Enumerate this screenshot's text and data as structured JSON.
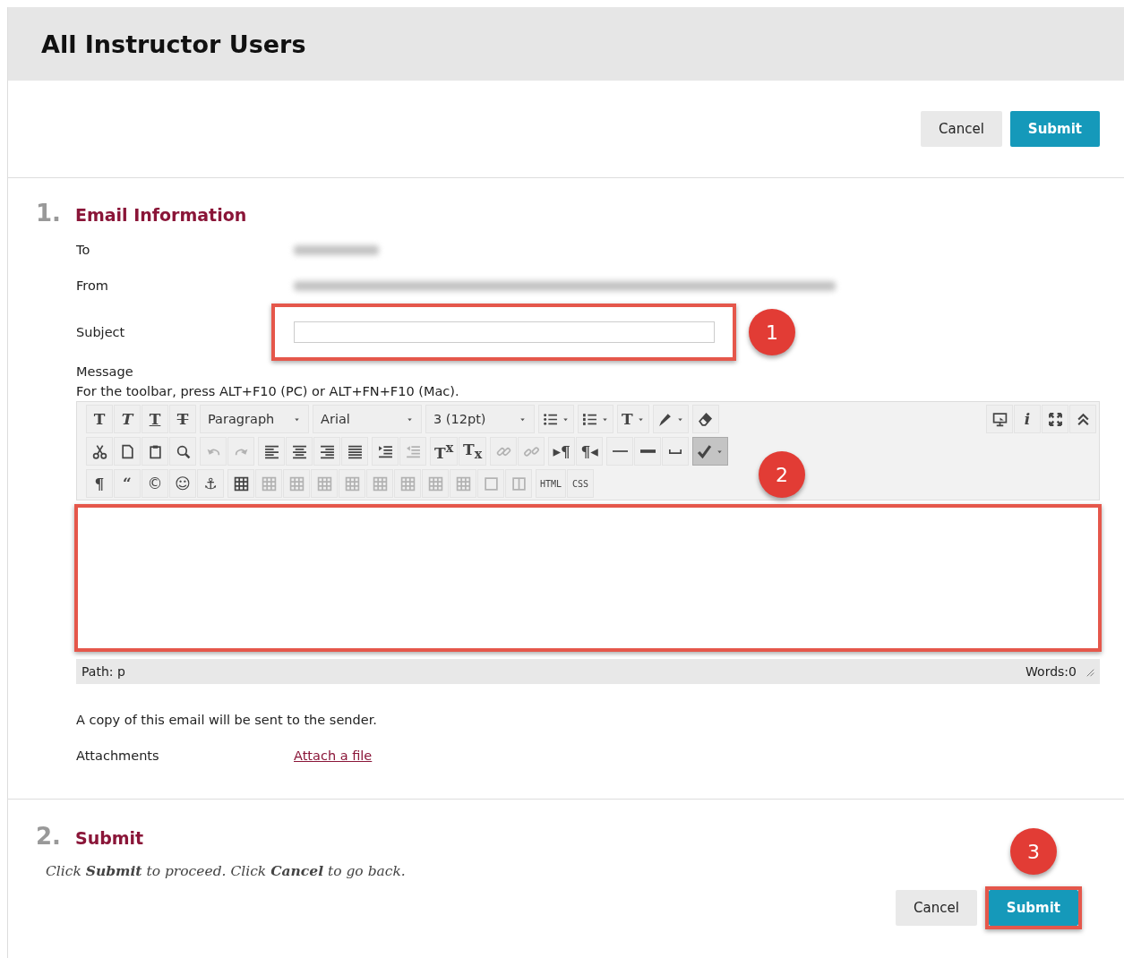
{
  "page": {
    "title": "All Instructor Users"
  },
  "top_buttons": [
    {
      "label": "Cancel",
      "kind": "secondary",
      "highlighted": false
    },
    {
      "label": "Submit",
      "kind": "primary",
      "highlighted": false
    }
  ],
  "email_section": {
    "number": "1.",
    "title": "Email Information",
    "fields": [
      {
        "label": "To",
        "kind": "redacted"
      },
      {
        "label": "From",
        "kind": "redacted"
      },
      {
        "label": "Subject",
        "kind": "input",
        "highlighted": true,
        "callout": "1"
      }
    ],
    "message": {
      "label": "Message",
      "hint": "For the toolbar, press ALT+F10 (PC) or ALT+FN+F10 (Mac).",
      "toolbar": {
        "rows": [
          {
            "groups": [
              {
                "items": [
                  {
                    "kind": "glyph",
                    "glyph": "T",
                    "caret": false,
                    "disabled": false,
                    "pressed": false
                  },
                  {
                    "kind": "glyph",
                    "glyph": "T",
                    "caret": false,
                    "disabled": false,
                    "pressed": false
                  },
                  {
                    "kind": "glyph",
                    "glyph": "T",
                    "caret": false,
                    "disabled": false,
                    "pressed": false
                  },
                  {
                    "kind": "glyph",
                    "glyph": "T",
                    "caret": false,
                    "disabled": false,
                    "pressed": false
                  }
                ]
              },
              {
                "items": [
                  {
                    "kind": "select",
                    "label": "Paragraph",
                    "caret": true,
                    "disabled": false,
                    "pressed": false
                  }
                ]
              },
              {
                "items": [
                  {
                    "kind": "select",
                    "label": "Arial",
                    "caret": true,
                    "disabled": false,
                    "pressed": false
                  }
                ]
              },
              {
                "items": [
                  {
                    "kind": "select",
                    "label": "3 (12pt)",
                    "caret": true,
                    "disabled": false,
                    "pressed": false
                  }
                ]
              },
              {
                "items": [
                  {
                    "kind": "icon",
                    "caret": true,
                    "disabled": false,
                    "pressed": false
                  }
                ]
              },
              {
                "items": [
                  {
                    "kind": "icon",
                    "caret": true,
                    "disabled": false,
                    "pressed": false
                  }
                ]
              },
              {
                "items": [
                  {
                    "kind": "glyph",
                    "glyph": "T",
                    "caret": true,
                    "disabled": false,
                    "pressed": false
                  }
                ]
              },
              {
                "items": [
                  {
                    "kind": "icon",
                    "caret": true,
                    "disabled": false,
                    "pressed": false
                  }
                ]
              },
              {
                "items": [
                  {
                    "kind": "icon",
                    "caret": false,
                    "disabled": false,
                    "pressed": false
                  }
                ]
              }
            ],
            "end_groups": [
              {
                "items": [
                  {
                    "kind": "icon",
                    "caret": false,
                    "disabled": false,
                    "pressed": false
                  },
                  {
                    "kind": "glyph",
                    "glyph": "i",
                    "caret": false,
                    "disabled": false,
                    "pressed": false
                  },
                  {
                    "kind": "icon",
                    "caret": false,
                    "disabled": false,
                    "pressed": false
                  },
                  {
                    "kind": "icon",
                    "caret": false,
                    "disabled": false,
                    "pressed": false
                  }
                ]
              }
            ]
          },
          {
            "groups": [
              {
                "items": [
                  {
                    "kind": "icon",
                    "caret": false,
                    "disabled": false,
                    "pressed": false
                  },
                  {
                    "kind": "icon",
                    "caret": false,
                    "disabled": false,
                    "pressed": false
                  },
                  {
                    "kind": "icon",
                    "caret": false,
                    "disabled": false,
                    "pressed": false
                  },
                  {
                    "kind": "icon",
                    "caret": false,
                    "disabled": false,
                    "pressed": false
                  }
                ]
              },
              {
                "items": [
                  {
                    "kind": "icon",
                    "caret": false,
                    "disabled": true,
                    "pressed": false
                  },
                  {
                    "kind": "icon",
                    "caret": false,
                    "disabled": true,
                    "pressed": false
                  }
                ]
              },
              {
                "items": [
                  {
                    "kind": "icon",
                    "caret": false,
                    "disabled": false,
                    "pressed": false
                  },
                  {
                    "kind": "icon",
                    "caret": false,
                    "disabled": false,
                    "pressed": false
                  },
                  {
                    "kind": "icon",
                    "caret": false,
                    "disabled": false,
                    "pressed": false
                  },
                  {
                    "kind": "icon",
                    "caret": false,
                    "disabled": false,
                    "pressed": false
                  }
                ]
              },
              {
                "items": [
                  {
                    "kind": "icon",
                    "caret": false,
                    "disabled": false,
                    "pressed": false
                  },
                  {
                    "kind": "icon",
                    "caret": false,
                    "disabled": true,
                    "pressed": false
                  }
                ]
              },
              {
                "items": [
                  {
                    "kind": "glyph",
                    "glyph": "T$^{x}$",
                    "caret": false,
                    "disabled": false,
                    "pressed": false
                  },
                  {
                    "kind": "glyph",
                    "glyph": "T$_{x}$",
                    "caret": false,
                    "disabled": false,
                    "pressed": false
                  }
                ]
              },
              {
                "items": [
                  {
                    "kind": "icon",
                    "caret": false,
                    "disabled": true,
                    "pressed": false
                  },
                  {
                    "kind": "icon",
                    "caret": false,
                    "disabled": true,
                    "pressed": false
                  }
                ]
              },
              {
                "items": [
                  {
                    "kind": "glyph",
                    "glyph": "▸¶",
                    "caret": false,
                    "disabled": false,
                    "pressed": false
                  },
                  {
                    "kind": "glyph",
                    "glyph": "¶◂",
                    "caret": false,
                    "disabled": false,
                    "pressed": false
                  }
                ]
              },
              {
                "items": [
                  {
                    "kind": "icon",
                    "caret": false,
                    "disabled": false,
                    "pressed": false
                  },
                  {
                    "kind": "icon",
                    "caret": false,
                    "disabled": false,
                    "pressed": false
                  },
                  {
                    "kind": "icon",
                    "caret": false,
                    "disabled": false,
                    "pressed": false
                  }
                ]
              },
              {
                "items": [
                  {
                    "kind": "icon",
                    "caret": true,
                    "disabled": false,
                    "pressed": true
                  }
                ]
              }
            ]
          },
          {
            "groups": [
              {
                "items": [
                  {
                    "kind": "glyph",
                    "glyph": "¶",
                    "caret": false,
                    "disabled": false,
                    "pressed": false
                  },
                  {
                    "kind": "glyph",
                    "glyph": "“",
                    "caret": false,
                    "disabled": false,
                    "pressed": false
                  },
                  {
                    "kind": "glyph",
                    "glyph": "©",
                    "caret": false,
                    "disabled": false,
                    "pressed": false
                  },
                  {
                    "kind": "glyph",
                    "glyph": "☺",
                    "caret": false,
                    "disabled": false,
                    "pressed": false
                  },
                  {
                    "kind": "glyph",
                    "glyph": "⚓",
                    "caret": false,
                    "disabled": false,
                    "pressed": false
                  }
                ]
              },
              {
                "items": [
                  {
                    "kind": "icon",
                    "caret": false,
                    "disabled": false,
                    "pressed": false
                  },
                  {
                    "kind": "icon",
                    "caret": false,
                    "disabled": true,
                    "pressed": false
                  },
                  {
                    "kind": "icon",
                    "caret": false,
                    "disabled": true,
                    "pressed": false
                  },
                  {
                    "kind": "icon",
                    "caret": false,
                    "disabled": true,
                    "pressed": false
                  },
                  {
                    "kind": "icon",
                    "caret": false,
                    "disabled": true,
                    "pressed": false
                  },
                  {
                    "kind": "icon",
                    "caret": false,
                    "disabled": true,
                    "pressed": false
                  },
                  {
                    "kind": "icon",
                    "caret": false,
                    "disabled": true,
                    "pressed": false
                  },
                  {
                    "kind": "icon",
                    "caret": false,
                    "disabled": true,
                    "pressed": false
                  },
                  {
                    "kind": "icon",
                    "caret": false,
                    "disabled": true,
                    "pressed": false
                  },
                  {
                    "kind": "icon",
                    "caret": false,
                    "disabled": true,
                    "pressed": false
                  },
                  {
                    "kind": "icon",
                    "caret": false,
                    "disabled": true,
                    "pressed": false
                  }
                ]
              },
              {
                "items": [
                  {
                    "kind": "glyph",
                    "glyph": "HTML",
                    "caret": false,
                    "disabled": false,
                    "pressed": false
                  },
                  {
                    "kind": "glyph",
                    "glyph": "CSS",
                    "caret": false,
                    "disabled": false,
                    "pressed": false
                  }
                ]
              }
            ]
          }
        ]
      },
      "editor": {
        "highlighted": true,
        "callout": "2"
      },
      "path": "Path: p",
      "words": "Words:0"
    },
    "copy_note": "A copy of this email will be sent to the sender.",
    "attachments": {
      "label": "Attachments",
      "link": "Attach a file"
    }
  },
  "submit_section": {
    "number": "2.",
    "title": "Submit",
    "instructions": "Click **Submit** to proceed. Click **Cancel** to go back."
  },
  "bottom_buttons": [
    {
      "label": "Cancel",
      "kind": "secondary",
      "highlighted": false
    },
    {
      "label": "Submit",
      "kind": "primary",
      "highlighted": true,
      "callout": "3"
    }
  ]
}
